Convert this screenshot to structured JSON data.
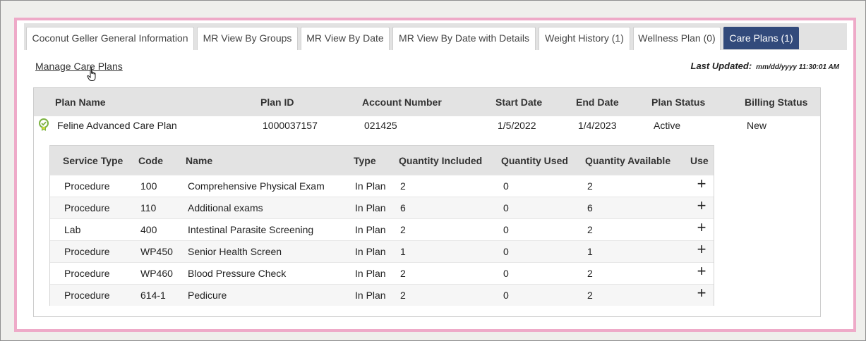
{
  "tabs": [
    {
      "label": "Coconut Geller General Information",
      "active": false
    },
    {
      "label": "MR View By Groups",
      "active": false
    },
    {
      "label": "MR View By Date",
      "active": false
    },
    {
      "label": "MR View By Date with Details",
      "active": false
    },
    {
      "label": "Weight History (1)",
      "active": false
    },
    {
      "label": "Wellness Plan (0)",
      "active": false
    },
    {
      "label": "Care Plans (1)",
      "active": true
    }
  ],
  "manage_link": "Manage Care Plans",
  "last_updated": {
    "label": "Last Updated:",
    "value": "mm/dd/yyyy 11:30:01 AM"
  },
  "plans_table": {
    "headers": [
      "Plan Name",
      "Plan ID",
      "Account Number",
      "Start Date",
      "End Date",
      "Plan Status",
      "Billing Status"
    ],
    "row": {
      "plan_name": "Feline Advanced Care Plan",
      "plan_id": "1000037157",
      "account_number": "021425",
      "start_date": "1/5/2022",
      "end_date": "1/4/2023",
      "plan_status": "Active",
      "billing_status": "New",
      "status_icon": "check-badge-icon"
    }
  },
  "services_table": {
    "headers": [
      "Service Type",
      "Code",
      "Name",
      "Type",
      "Quantity Included",
      "Quantity Used",
      "Quantity Available",
      "Use"
    ],
    "rows": [
      {
        "service_type": "Procedure",
        "code": "100",
        "name": "Comprehensive Physical Exam",
        "type": "In Plan",
        "included": "2",
        "used": "0",
        "available": "2",
        "use": "+"
      },
      {
        "service_type": "Procedure",
        "code": "110",
        "name": "Additional exams",
        "type": "In Plan",
        "included": "6",
        "used": "0",
        "available": "6",
        "use": "+"
      },
      {
        "service_type": "Lab",
        "code": "400",
        "name": "Intestinal Parasite Screening",
        "type": "In Plan",
        "included": "2",
        "used": "0",
        "available": "2",
        "use": "+"
      },
      {
        "service_type": "Procedure",
        "code": "WP450",
        "name": "Senior Health Screen",
        "type": "In Plan",
        "included": "1",
        "used": "0",
        "available": "1",
        "use": "+"
      },
      {
        "service_type": "Procedure",
        "code": "WP460",
        "name": "Blood Pressure Check",
        "type": "In Plan",
        "included": "2",
        "used": "0",
        "available": "2",
        "use": "+"
      },
      {
        "service_type": "Procedure",
        "code": "614-1",
        "name": "Pedicure",
        "type": "In Plan",
        "included": "2",
        "used": "0",
        "available": "2",
        "use": "+"
      }
    ]
  },
  "colors": {
    "active_tab": "#324a7b",
    "highlight_border": "#eeaac8",
    "status_icon": "#7cb342"
  }
}
